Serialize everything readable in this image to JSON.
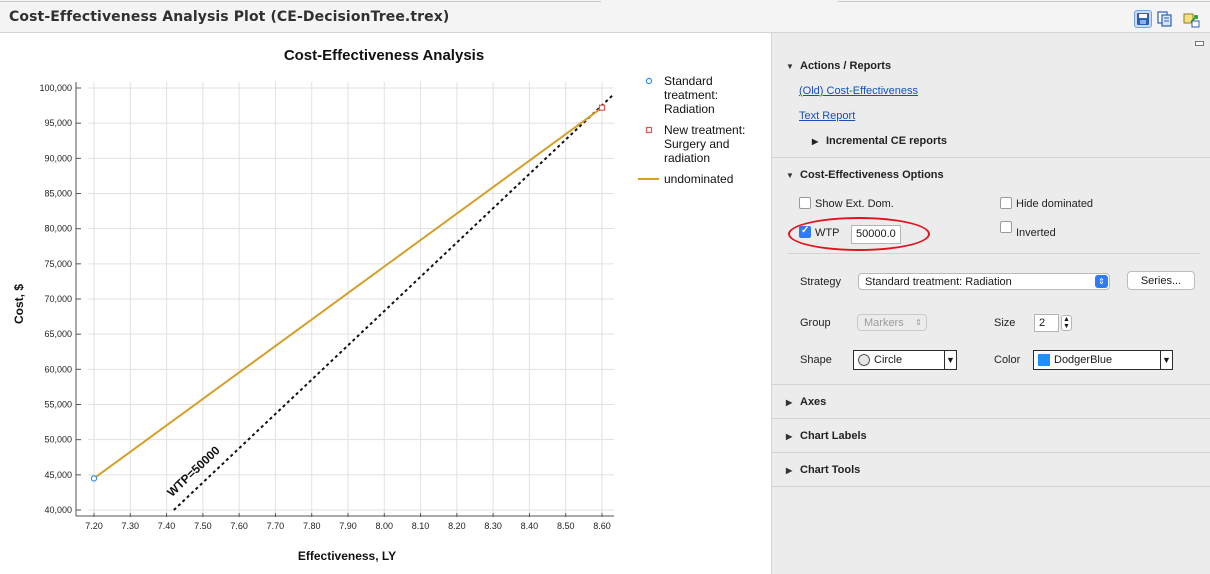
{
  "window": {
    "title": "Cost-Effectiveness Analysis Plot (CE-DecisionTree.trex)"
  },
  "toolbar": {
    "save_icon": "save-icon",
    "copy_icon": "copy-icon",
    "export_icon": "export-icon"
  },
  "chart": {
    "wtp_label": "WTP=50000",
    "colors": {
      "undominated": "#d4a02a",
      "standard_marker": "#2f8ee6",
      "new_marker": "#e05656"
    }
  },
  "chart_data": {
    "type": "scatter",
    "title": "Cost-Effectiveness Analysis",
    "xlabel": "Effectiveness, LY",
    "ylabel": "Cost, $",
    "xlim": [
      7.2,
      8.6
    ],
    "ylim": [
      40000,
      100000
    ],
    "x_ticks": [
      "7.20",
      "7.30",
      "7.40",
      "7.50",
      "7.60",
      "7.70",
      "7.80",
      "7.90",
      "8.00",
      "8.10",
      "8.20",
      "8.30",
      "8.40",
      "8.50",
      "8.60"
    ],
    "x_tick_values": [
      7.2,
      7.3,
      7.4,
      7.5,
      7.6,
      7.7,
      7.8,
      7.9,
      8.0,
      8.1,
      8.2,
      8.3,
      8.4,
      8.5,
      8.6
    ],
    "y_ticks": [
      "40,000",
      "45,000",
      "50,000",
      "55,000",
      "60,000",
      "65,000",
      "70,000",
      "75,000",
      "80,000",
      "85,000",
      "90,000",
      "95,000",
      "100,000"
    ],
    "y_tick_values": [
      40000,
      45000,
      50000,
      55000,
      60000,
      65000,
      70000,
      75000,
      80000,
      85000,
      90000,
      95000,
      100000
    ],
    "grid": true,
    "legend_position": "right",
    "series": [
      {
        "name": "Standard treatment: Radiation",
        "marker": "circle",
        "points": [
          [
            7.2,
            44500
          ]
        ]
      },
      {
        "name": "New treatment: Surgery and radiation",
        "marker": "square",
        "points": [
          [
            8.6,
            97200
          ]
        ]
      },
      {
        "name": "undominated",
        "kind": "line",
        "points": [
          [
            7.2,
            44500
          ],
          [
            8.6,
            97200
          ]
        ]
      }
    ],
    "wtp_line": {
      "points": [
        [
          7.42,
          40000
        ],
        [
          8.63,
          99000
        ]
      ]
    },
    "legend": [
      {
        "lines": [
          "Standard",
          "treatment:",
          "Radiation"
        ],
        "marker": "circle"
      },
      {
        "lines": [
          "New treatment:",
          "Surgery and",
          "radiation"
        ],
        "marker": "square"
      },
      {
        "lines": [
          "undominated"
        ],
        "marker": "line"
      }
    ]
  },
  "panel": {
    "actions": {
      "header": "Actions / Reports",
      "link_old_ce": "(Old) Cost-Effectiveness",
      "link_text_report": "Text Report",
      "incremental": "Incremental CE reports"
    },
    "options": {
      "header": "Cost-Effectiveness Options",
      "show_ext_dom": "Show Ext. Dom.",
      "hide_dominated": "Hide dominated",
      "wtp": "WTP",
      "wtp_value": "50000.0",
      "inverted": "Inverted",
      "strategy_label": "Strategy",
      "strategy_value": "Standard treatment: Radiation",
      "series_button": "Series...",
      "group_label": "Group",
      "group_value": "Markers",
      "size_label": "Size",
      "size_value": "2",
      "shape_label": "Shape",
      "shape_value": "Circle",
      "color_label": "Color",
      "color_value": "DodgerBlue"
    },
    "axes": "Axes",
    "chart_labels": "Chart Labels",
    "chart_tools": "Chart Tools"
  }
}
